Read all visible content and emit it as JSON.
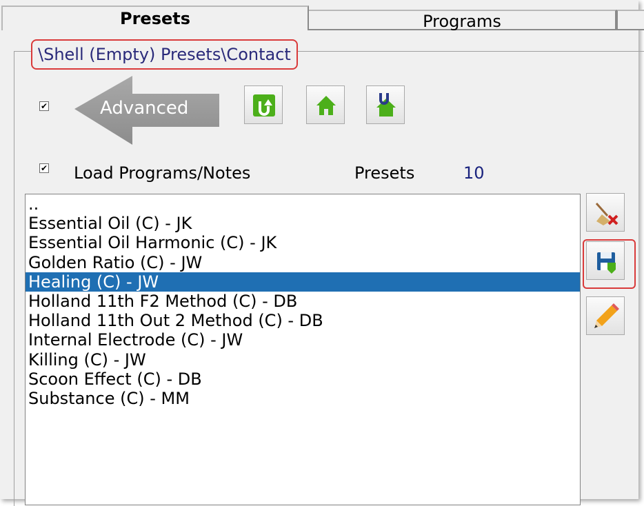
{
  "tabs": [
    {
      "label": "Presets",
      "active": true
    },
    {
      "label": "Programs",
      "active": false
    }
  ],
  "path": "\\Shell (Empty) Presets\\Contact",
  "advanced": {
    "label": "Advanced",
    "checked": true
  },
  "toolbar": {
    "icons": [
      "refresh-icon",
      "home-icon",
      "up-home-icon"
    ]
  },
  "load_programs": {
    "label": "Load Programs/Notes",
    "checked": true
  },
  "presets_summary": {
    "label": "Presets",
    "count": "10"
  },
  "list": {
    "items": [
      "..",
      "Essential Oil (C) - JK",
      "Essential Oil Harmonic (C) - JK",
      "Golden Ratio (C) - JW",
      "Healing (C) - JW",
      "Holland 11th F2 Method (C) - DB",
      "Holland 11th Out 2 Method (C) - DB",
      "Internal Electrode (C) - JW",
      "Killing (C) - JW",
      "Scoon Effect (C) - DB",
      "Substance (C) - MM"
    ],
    "selected_index": 4
  },
  "side_buttons": [
    "clear-icon",
    "save-icon",
    "edit-pencil-icon"
  ],
  "colors": {
    "selection": "#1f6fb3",
    "highlight_border": "#d93a3a",
    "button_green": "#4caf1a",
    "path_text": "#2a2a7a"
  }
}
